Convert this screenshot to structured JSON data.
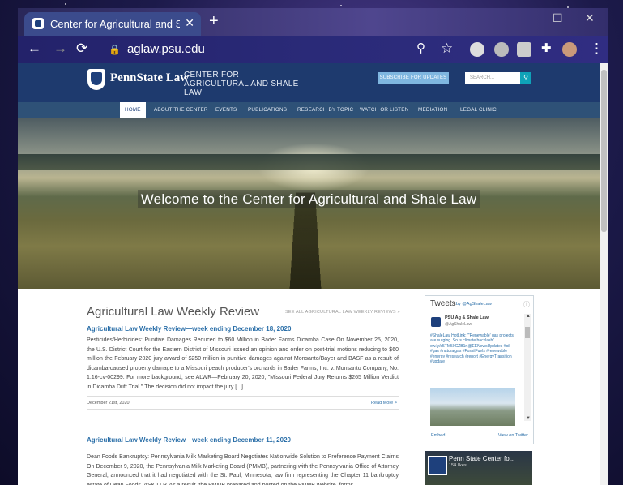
{
  "browser": {
    "tab_title": "Center for Agricultural and Shale",
    "new_tab": "+",
    "url": "aglaw.psu.edu"
  },
  "site": {
    "brand": "PennState Law",
    "center_name": "CENTER FOR AGRICULTURAL AND SHALE LAW",
    "subscribe_label": "SUBSCRIBE FOR UPDATES",
    "search_placeholder": "SEARCH...",
    "nav": [
      "HOME",
      "ABOUT THE CENTER",
      "EVENTS",
      "PUBLICATIONS",
      "RESEARCH BY TOPIC",
      "WATCH OR LISTEN",
      "MEDIATION",
      "LEGAL CLINIC"
    ],
    "hero_title": "Welcome to the Center for Agricultural and Shale Law"
  },
  "review": {
    "section_title": "Agricultural Law Weekly Review",
    "see_all": "SEE ALL AGRICULTURAL LAW WEEKLY REVIEWS »",
    "posts": [
      {
        "title": "Agricultural Law Weekly Review—week ending December 18, 2020",
        "body": "Pesticides/Herbicides: Punitive Damages Reduced to $60 Million in Bader Farms Dicamba Case On November 25, 2020, the U.S. District Court for the Eastern District of Missouri issued an opinion and order on post-trial motions reducing to $60 million the February 2020 jury award of $250 million in punitive damages against Monsanto/Bayer and BASF as a result of dicamba-caused property damage to a Missouri peach producer's orchards in Bader Farms, Inc. v. Monsanto Company, No. 1:16-cv-00299. For more background, see ALWR—February 20, 2020, \"Missouri Federal Jury Returns $265 Million Verdict in Dicamba Drift Trial.\" The decision did not impact the jury [...]",
        "date": "December 21st, 2020",
        "read_more": "Read More >"
      },
      {
        "title": "Agricultural Law Weekly Review—week ending December 11, 2020",
        "body": "Dean Foods Bankruptcy: Pennsylvania Milk Marketing Board Negotiates Nationwide Solution to Preference Payment Claims On December 9, 2020, the Pennsylvania Milk Marketing Board (PMMB), partnering with the Pennsylvania Office of Attorney General, announced that it had negotiated with the St. Paul, Minnesota, law firm representing the Chapter 11 bankruptcy estate of Dean Foods, ASK LLP. As a result, the PMMB prepared and posted on the PMMB website, forms"
      }
    ]
  },
  "twitter": {
    "title": "Tweets",
    "by": "by @AgShaleLaw",
    "name": "PSU Ag & Shale Law",
    "handle": "@AgShaleLaw",
    "text": "#ShaleLaw HotLink: \"'Renewable' gas projects are surging. So is climate backlash\" ow.ly/s5TM50CZB1r @EENewsUpdates #oil #gas #naturalgas #FossilFuels #renewable #energy #research #report #EnergyTransition #update",
    "embed": "Embed",
    "view": "View on Twitter"
  },
  "facebook": {
    "name": "Penn State Center fo...",
    "likes": "154 likes"
  }
}
